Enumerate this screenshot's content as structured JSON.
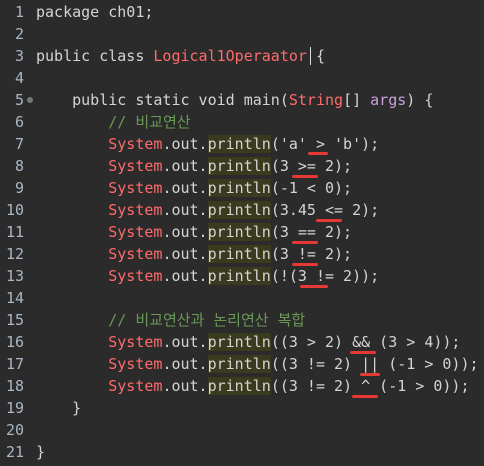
{
  "line_numbers": [
    "1",
    "2",
    "3",
    "4",
    "5",
    "6",
    "7",
    "8",
    "9",
    "10",
    "11",
    "12",
    "13",
    "14",
    "15",
    "16",
    "17",
    "18",
    "19",
    "20",
    "21"
  ],
  "lines": {
    "l1_pkg": "package",
    "l1_name": " ch01;",
    "l3_a": "public class ",
    "l3_cls": "Logical1Operaator",
    "l3_b": " {",
    "l5_a": "    public static void ",
    "l5_main": "main",
    "l5_b": "(",
    "l5_str": "String",
    "l5_c": "[] ",
    "l5_args": "args",
    "l5_d": ") {",
    "l6": "        // 비교연산",
    "sys": "System",
    "dot_out": ".out.",
    "println": "println",
    "l7_tail": "('a' > 'b');",
    "l8_tail": "(3 >= 2);",
    "l9_tail": "(-1 < 0);",
    "l10_tail": "(3.45 <= 2);",
    "l11_tail": "(3 == 2);",
    "l12_tail": "(3 != 2);",
    "l13_tail": "(!(3 != 2));",
    "l15": "        // 비교연산과 논리연산 복합",
    "l16_tail": "((3 > 2) && (3 > 4));",
    "l17_tail": "((3 != 2) || (-1 > 0));",
    "l18_tail": "((3 != 2) ^ (-1 > 0));",
    "l19": "    }",
    "l21": "}"
  }
}
